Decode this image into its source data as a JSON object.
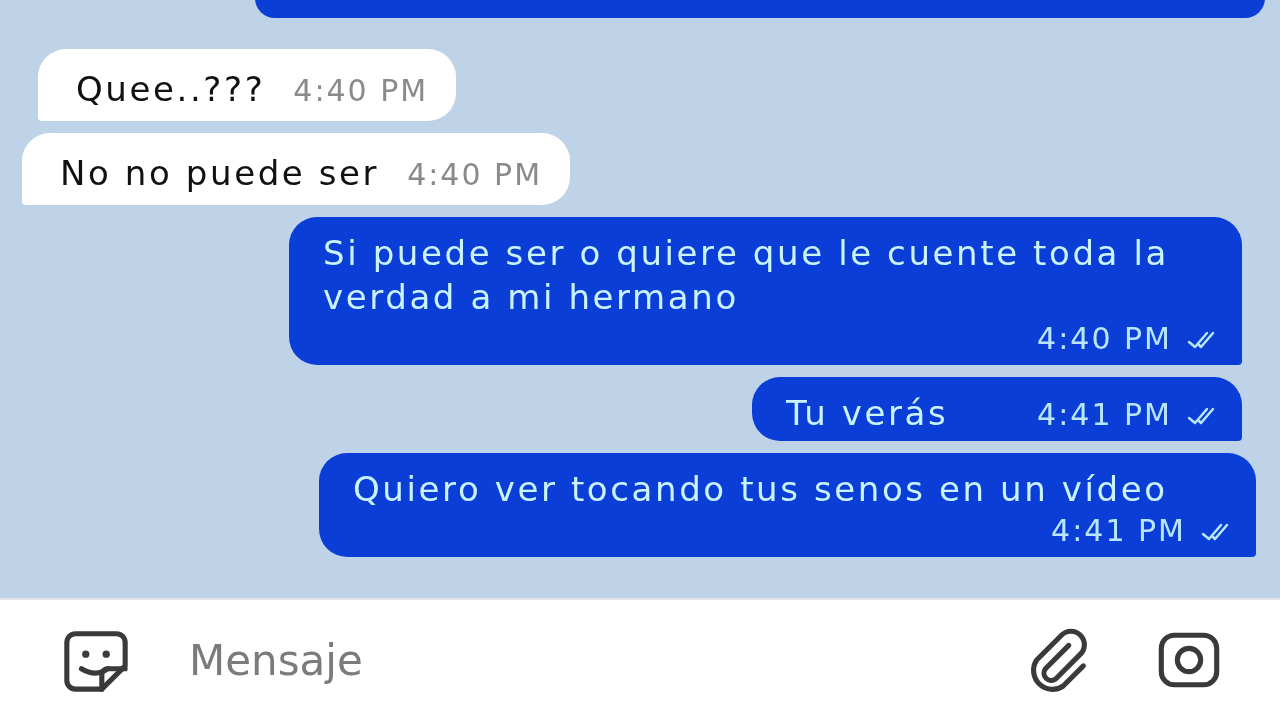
{
  "messages": [
    {
      "outgoing": true,
      "kind": "cut"
    },
    {
      "outgoing": false,
      "kind": "text",
      "text": "Quee..???",
      "time": "4:40 PM"
    },
    {
      "outgoing": false,
      "kind": "text",
      "text": "No no puede ser",
      "time": "4:40 PM"
    },
    {
      "outgoing": true,
      "kind": "text",
      "text": "Si puede ser o quiere que le cuente toda la verdad a mi hermano",
      "time": "4:40 PM",
      "read": true
    },
    {
      "outgoing": true,
      "kind": "text",
      "text": "Tu verás",
      "time": "4:41 PM",
      "read": true
    },
    {
      "outgoing": true,
      "kind": "text",
      "text": "Quiero ver tocando tus senos en un vídeo",
      "time": "4:41 PM",
      "read": true
    }
  ],
  "composer": {
    "placeholder": "Mensaje"
  }
}
